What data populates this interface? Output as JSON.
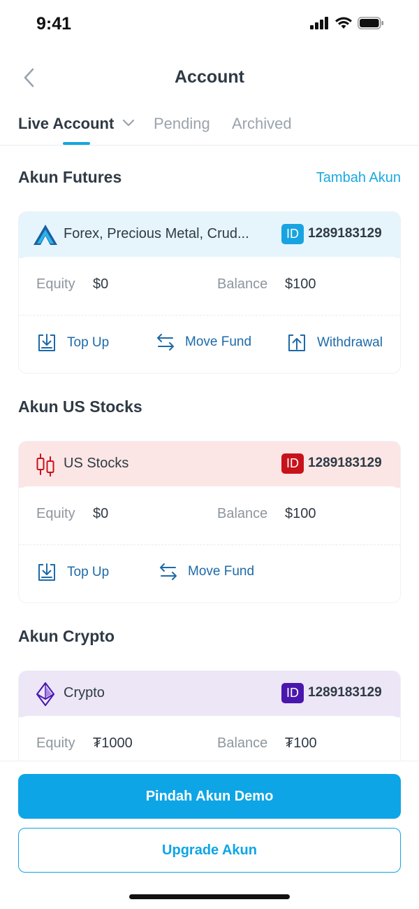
{
  "status_bar": {
    "time": "9:41"
  },
  "nav": {
    "title": "Account"
  },
  "tabs": [
    {
      "label": "Live Account",
      "active": true
    },
    {
      "label": "Pending",
      "active": false
    },
    {
      "label": "Archived",
      "active": false
    }
  ],
  "sections": {
    "futures": {
      "title": "Akun Futures",
      "link": "Tambah Akun",
      "card": {
        "name": "Forex, Precious Metal, Crud...",
        "id_badge": "ID",
        "id_number": "1289183129",
        "equity_label": "Equity",
        "equity_value": "$0",
        "balance_label": "Balance",
        "balance_value": "$100",
        "actions": [
          "Top Up",
          "Move Fund",
          "Withdrawal"
        ]
      }
    },
    "stocks": {
      "title": "Akun US Stocks",
      "card": {
        "name": "US Stocks",
        "id_badge": "ID",
        "id_number": "1289183129",
        "equity_label": "Equity",
        "equity_value": "$0",
        "balance_label": "Balance",
        "balance_value": "$100",
        "actions": [
          "Top Up",
          "Move Fund"
        ]
      }
    },
    "crypto": {
      "title": "Akun Crypto",
      "card": {
        "name": "Crypto",
        "id_badge": "ID",
        "id_number": "1289183129",
        "equity_label": "Equity",
        "equity_value": "₮1000",
        "balance_label": "Balance",
        "balance_value": "₮100"
      }
    }
  },
  "buttons": {
    "primary": "Pindah Akun Demo",
    "secondary": "Upgrade Akun"
  },
  "colors": {
    "accent": "#0ea5e6",
    "futures_badge": "#17a4e0",
    "stocks_badge": "#c8121a",
    "crypto_badge": "#4a17ad",
    "action_text": "#1d6aa8"
  },
  "icons": [
    "signal-icon",
    "wifi-icon",
    "battery-icon",
    "back-chevron-icon",
    "chevron-down-icon",
    "futures-logo-icon",
    "candlestick-icon",
    "ethereum-icon",
    "top-up-icon",
    "move-fund-icon",
    "withdrawal-icon"
  ]
}
